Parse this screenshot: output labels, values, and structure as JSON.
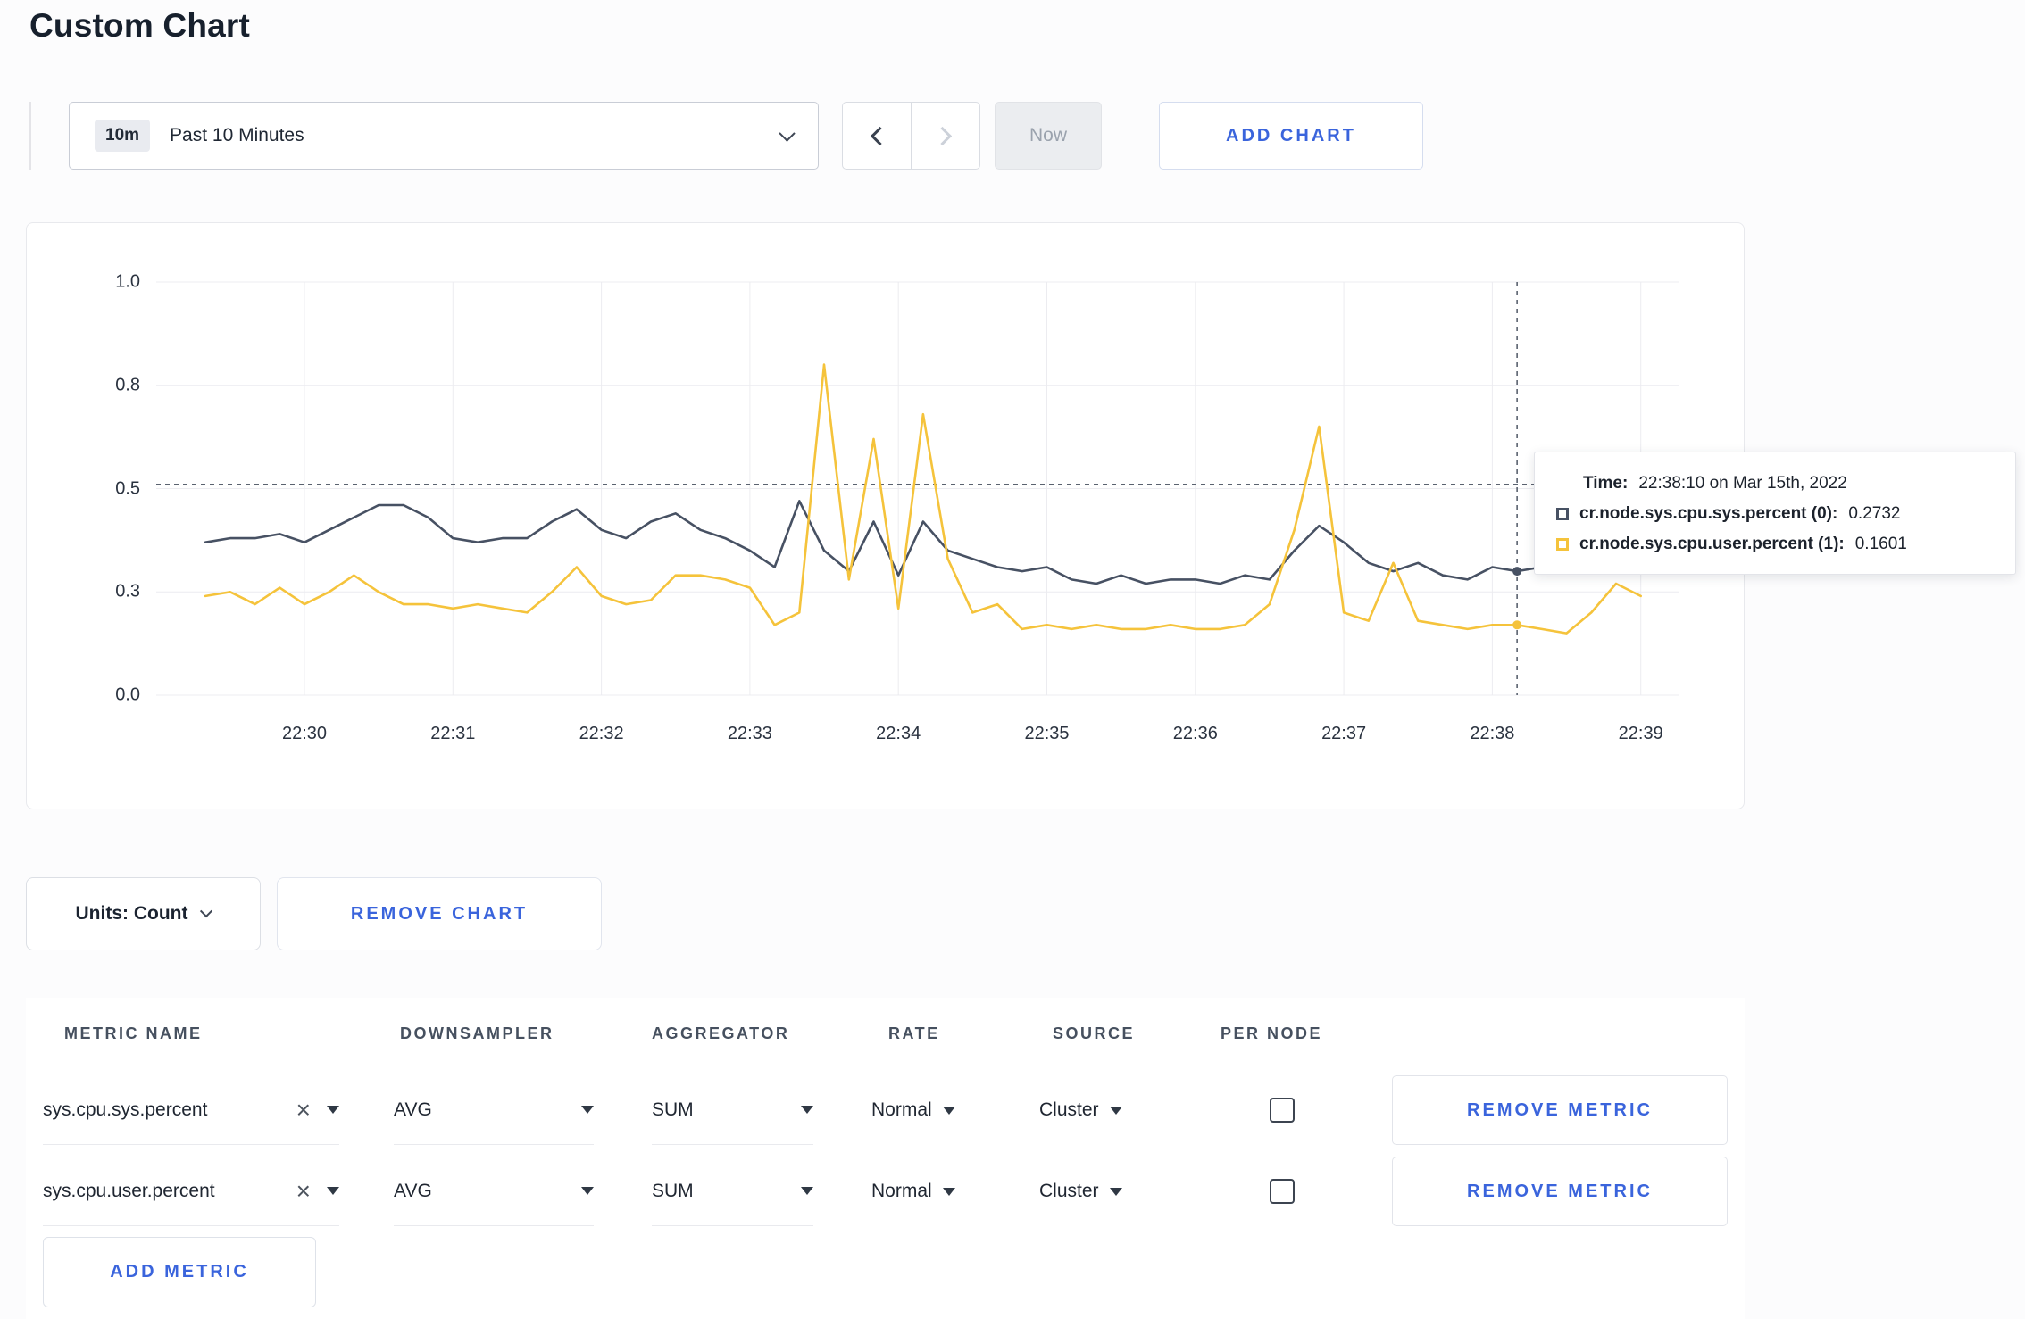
{
  "page": {
    "title": "Custom Chart"
  },
  "toolbar": {
    "time_badge": "10m",
    "time_label": "Past 10 Minutes",
    "now_label": "Now",
    "add_chart_label": "ADD CHART"
  },
  "chart": {
    "units_label": "Units: Count",
    "remove_chart_label": "REMOVE CHART",
    "tooltip": {
      "time_label": "Time:",
      "time_value": "22:38:10 on Mar 15th, 2022",
      "series": [
        {
          "name": "cr.node.sys.cpu.sys.percent (0):",
          "value": "0.2732"
        },
        {
          "name": "cr.node.sys.cpu.user.percent (1):",
          "value": "0.1601"
        }
      ]
    }
  },
  "chart_data": {
    "type": "line",
    "x_start": "22:29:20",
    "x_interval_seconds": 10,
    "x_ticks": [
      "22:30",
      "22:31",
      "22:32",
      "22:33",
      "22:34",
      "22:35",
      "22:36",
      "22:37",
      "22:38",
      "22:39"
    ],
    "ylim": [
      0,
      1.0
    ],
    "y_tick_values": [
      0,
      0.25,
      0.5,
      0.75,
      1.0
    ],
    "y_tick_labels": [
      "0.0",
      "0.3",
      "0.5",
      "0.8",
      "1.0"
    ],
    "grid": true,
    "crosshair": {
      "x_time": "22:38:10",
      "y_value": 0.51
    },
    "series": [
      {
        "name": "cr.node.sys.cpu.sys.percent",
        "color": "#475163",
        "values": [
          0.37,
          0.38,
          0.38,
          0.39,
          0.37,
          0.4,
          0.43,
          0.46,
          0.46,
          0.43,
          0.38,
          0.37,
          0.38,
          0.38,
          0.42,
          0.45,
          0.4,
          0.38,
          0.42,
          0.44,
          0.4,
          0.38,
          0.35,
          0.31,
          0.47,
          0.35,
          0.3,
          0.42,
          0.29,
          0.42,
          0.35,
          0.33,
          0.31,
          0.3,
          0.31,
          0.28,
          0.27,
          0.29,
          0.27,
          0.28,
          0.28,
          0.27,
          0.29,
          0.28,
          0.35,
          0.41,
          0.37,
          0.32,
          0.3,
          0.32,
          0.29,
          0.28,
          0.31,
          0.3,
          0.31,
          0.3,
          0.3,
          0.31,
          0.3
        ]
      },
      {
        "name": "cr.node.sys.cpu.user.percent",
        "color": "#F5C33B",
        "values": [
          0.24,
          0.25,
          0.22,
          0.26,
          0.22,
          0.25,
          0.29,
          0.25,
          0.22,
          0.22,
          0.21,
          0.22,
          0.21,
          0.2,
          0.25,
          0.31,
          0.24,
          0.22,
          0.23,
          0.29,
          0.29,
          0.28,
          0.26,
          0.17,
          0.2,
          0.8,
          0.28,
          0.62,
          0.21,
          0.68,
          0.33,
          0.2,
          0.22,
          0.16,
          0.17,
          0.16,
          0.17,
          0.16,
          0.16,
          0.17,
          0.16,
          0.16,
          0.17,
          0.22,
          0.4,
          0.65,
          0.2,
          0.18,
          0.32,
          0.18,
          0.17,
          0.16,
          0.17,
          0.17,
          0.16,
          0.15,
          0.2,
          0.27,
          0.24
        ]
      }
    ]
  },
  "metrics_table": {
    "headers": [
      "METRIC NAME",
      "DOWNSAMPLER",
      "AGGREGATOR",
      "RATE",
      "SOURCE",
      "PER NODE"
    ],
    "remove_metric_label": "REMOVE METRIC",
    "add_metric_label": "ADD METRIC",
    "rows": [
      {
        "metric": "sys.cpu.sys.percent",
        "downsampler": "AVG",
        "aggregator": "SUM",
        "rate": "Normal",
        "source": "Cluster",
        "per_node_checked": false
      },
      {
        "metric": "sys.cpu.user.percent",
        "downsampler": "AVG",
        "aggregator": "SUM",
        "rate": "Normal",
        "source": "Cluster",
        "per_node_checked": false
      }
    ]
  }
}
